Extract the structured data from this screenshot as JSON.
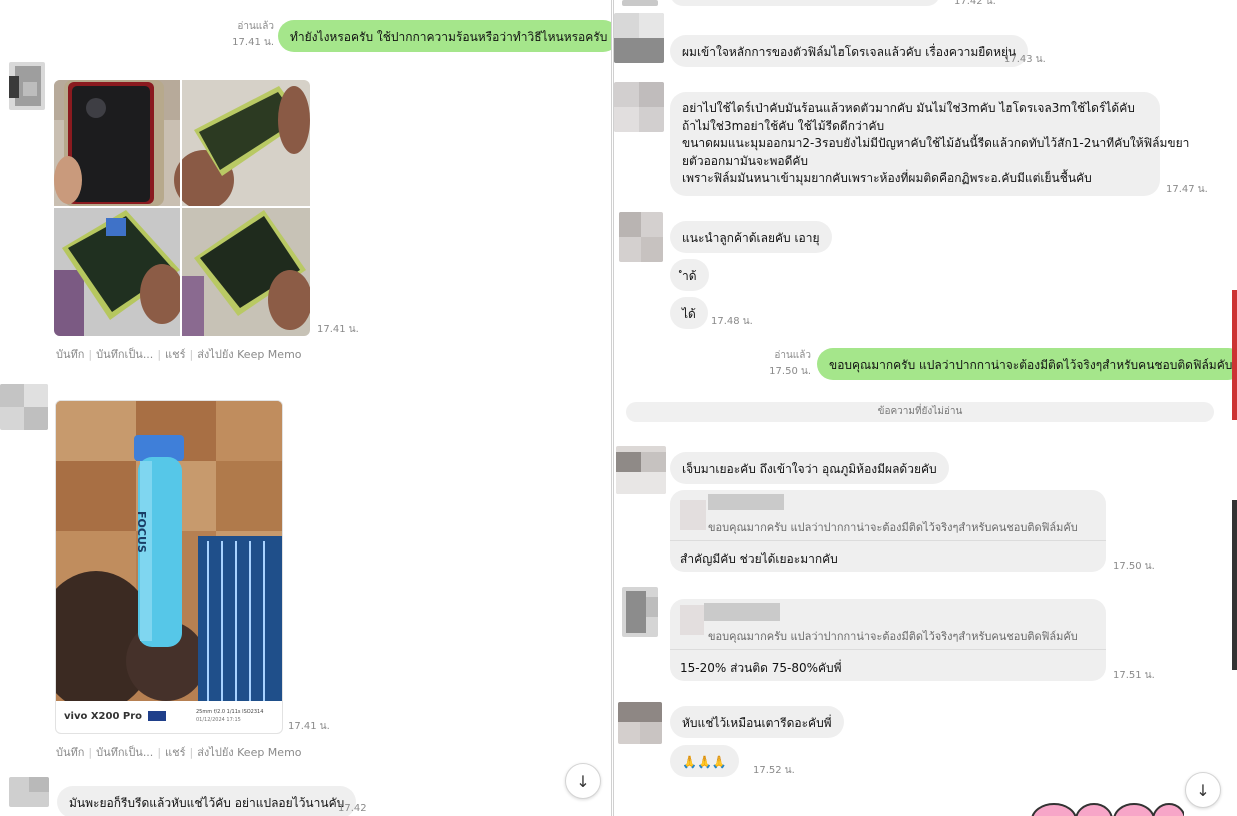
{
  "left": {
    "msg1": {
      "read": "อ่านแล้ว",
      "time": "17.41 น.",
      "text": "ทำยังไงหรอครับ ใช้ปากกาความร้อนหรือว่าทำวิธีไหนหรอครับ"
    },
    "photos1": {
      "time": "17.41 น."
    },
    "actions1": {
      "a1": "บันทึก",
      "a2": "บันทึกเป็น...",
      "a3": "แชร์",
      "a4": "ส่งไปยัง Keep Memo"
    },
    "photo2": {
      "time": "17.41 น.",
      "brand": "vivo X200 Pro",
      "specs": "25mm f/2.0 1/11s ISO2314",
      "date": "01/12/2024 17:15",
      "product": "FOCUS"
    },
    "actions2": {
      "a1": "บันทึก",
      "a2": "บันทึกเป็น...",
      "a3": "แชร์",
      "a4": "ส่งไปยัง Keep Memo"
    },
    "msg_last": {
      "text": "มันพะยอก็รีบรีดแล้วหับแช่ไว้คับ อย่าแปลอยไว้นานคับ",
      "time": "17.42"
    }
  },
  "right": {
    "msg_top": {
      "time": "17.42 น."
    },
    "msg1": {
      "text": "ผมเข้าใจหลักการของตัวฟิล์มไฮโดรเจลแล้วคับ เรื่องความยืดหยุ่น",
      "time": "17.43 น."
    },
    "msg2": {
      "line1": "อย่าไปใช้ไดร์เป่าคับมันร้อนแล้วหดตัวมากคับ มันไม่ใช่3mคับ ไฮโดรเจล3mใช้ไดร์ได้คับ",
      "line2": "ถ้าไม่ใช่3mอย่าใช้คับ ใช้ไม้รีดดีกว่าคับ",
      "line3": "ขนาดผมแนะมุมออกมา2-3รอบยังไม่มีปัญหาคับใช้ไม้อันนี้รีดแล้วกดทับไว้สัก1-2นาทีคับให้ฟิล์มขยา",
      "line4": "ยตัวออกมามันจะพอดีคับ",
      "line5": "เพราะฟิล์มมันหนาเข้ามุมยากคับเพราะห้องที่ผมติดคือกฏิพระอ.คับมีแต่เย็นชื้นคับ",
      "time": "17.47 น."
    },
    "msg3": {
      "text": "แนะนำลูกค้าด้เลยคับ เอายุ"
    },
    "msg4": {
      "text": "ำด้"
    },
    "msg5": {
      "text": "ได้",
      "time": "17.48 น."
    },
    "msg6": {
      "read": "อ่านแล้ว",
      "time": "17.50 น.",
      "text": "ขอบคุณมากครับ แปลว่าปากกาน่าจะต้องมีติดไว้จริงๆสำหรับคนชอบติดฟิล์มคับ"
    },
    "unread_divider": "ข้อความที่ยังไม่อ่าน",
    "msg7": {
      "text": "เจ็บมาเยอะคับ ถึงเข้าใจว่า อุณภูมิห้องมีผลด้วยคับ"
    },
    "reply1": {
      "quote": "ขอบคุณมากครับ แปลว่าปากกาน่าจะต้องมีติดไว้จริงๆสำหรับคนชอบติดฟิล์มคับ",
      "text": "สำคัญมีคับ ช่วยได้เยอะมากคับ",
      "time": "17.50 น."
    },
    "reply2": {
      "quote": "ขอบคุณมากครับ แปลว่าปากกาน่าจะต้องมีติดไว้จริงๆสำหรับคนชอบติดฟิล์มคับ",
      "text": "15-20% ส่วนติด 75-80%คับพี่",
      "time": "17.51 น."
    },
    "msg8": {
      "text": "หับแช่ไว้เหมือนเตารีดอะคับพี่"
    },
    "msg9": {
      "text": "🙏🙏🙏",
      "time": "17.52 น."
    }
  },
  "icons": {
    "scroll_down": "↓"
  }
}
